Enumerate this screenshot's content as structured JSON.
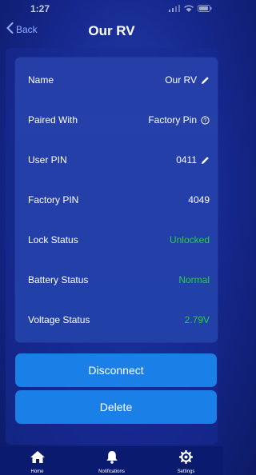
{
  "status_bar": {
    "time": "1:27"
  },
  "nav": {
    "back_label": "Back",
    "title": "Our RV"
  },
  "info": {
    "rows": [
      {
        "label": "Name",
        "value": "Our RV",
        "icon": "pencil-icon"
      },
      {
        "label": "Paired With",
        "value": "Factory Pin",
        "icon": "help-circle-icon"
      },
      {
        "label": "User PIN",
        "value": "0411",
        "icon": "pencil-icon"
      },
      {
        "label": "Factory PIN",
        "value": "4049"
      },
      {
        "label": "Lock Status",
        "value": "Unlocked",
        "color": "#2ecc40"
      },
      {
        "label": "Battery Status",
        "value": "Normal",
        "color": "#2ecc40"
      },
      {
        "label": "Voltage Status",
        "value": "2.79V",
        "color": "#2ecc40"
      }
    ]
  },
  "actions": {
    "disconnect_label": "Disconnect",
    "delete_label": "Delete"
  },
  "tabs": [
    {
      "label": "Home",
      "icon": "home-icon"
    },
    {
      "label": "Notifications",
      "icon": "bell-icon"
    },
    {
      "label": "Settings",
      "icon": "gear-icon"
    }
  ],
  "colors": {
    "accent": "#1a7fe6",
    "success": "#2ecc40",
    "background": "#15278c"
  }
}
